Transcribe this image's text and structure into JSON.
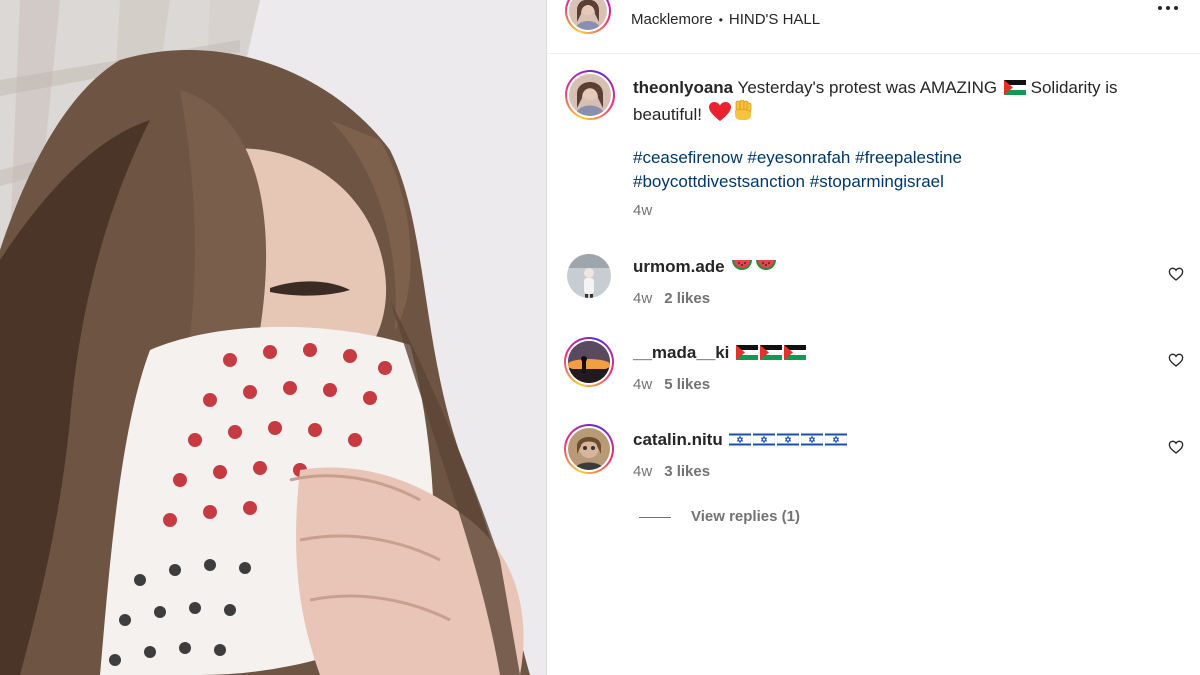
{
  "post": {
    "music": {
      "artist": "Macklemore",
      "separator": "•",
      "song": "HIND'S HALL"
    },
    "caption": {
      "username": "theonlyoana",
      "text_part1": "Yesterday's protest was AMAZING",
      "text_part2": "Solidarity is beautiful!",
      "hashtags": [
        "#ceasefirenow",
        "#eyesonrafah",
        "#freepalestine",
        "#boycottdivestsanction",
        "#stoparmingisrael"
      ],
      "time": "4w"
    }
  },
  "comments": [
    {
      "username": "urmom.ade",
      "emojis": [
        "watermelon",
        "watermelon"
      ],
      "time": "4w",
      "likes": "2 likes"
    },
    {
      "username": "__mada__ki",
      "emojis": [
        "palestine-flag",
        "palestine-flag",
        "palestine-flag"
      ],
      "time": "4w",
      "likes": "5 likes"
    },
    {
      "username": "catalin.nitu",
      "emojis": [
        "israel-flag",
        "israel-flag",
        "israel-flag",
        "israel-flag",
        "israel-flag"
      ],
      "time": "4w",
      "likes": "3 likes"
    }
  ],
  "replies": {
    "label": "View replies (1)"
  },
  "icons": {
    "more": "more-horizontal-icon",
    "like": "heart-outline-icon"
  },
  "colors": {
    "hashtag": "#00376b",
    "secondary_text": "#737373",
    "primary_text": "#262626",
    "divider": "#dbdbdb"
  }
}
